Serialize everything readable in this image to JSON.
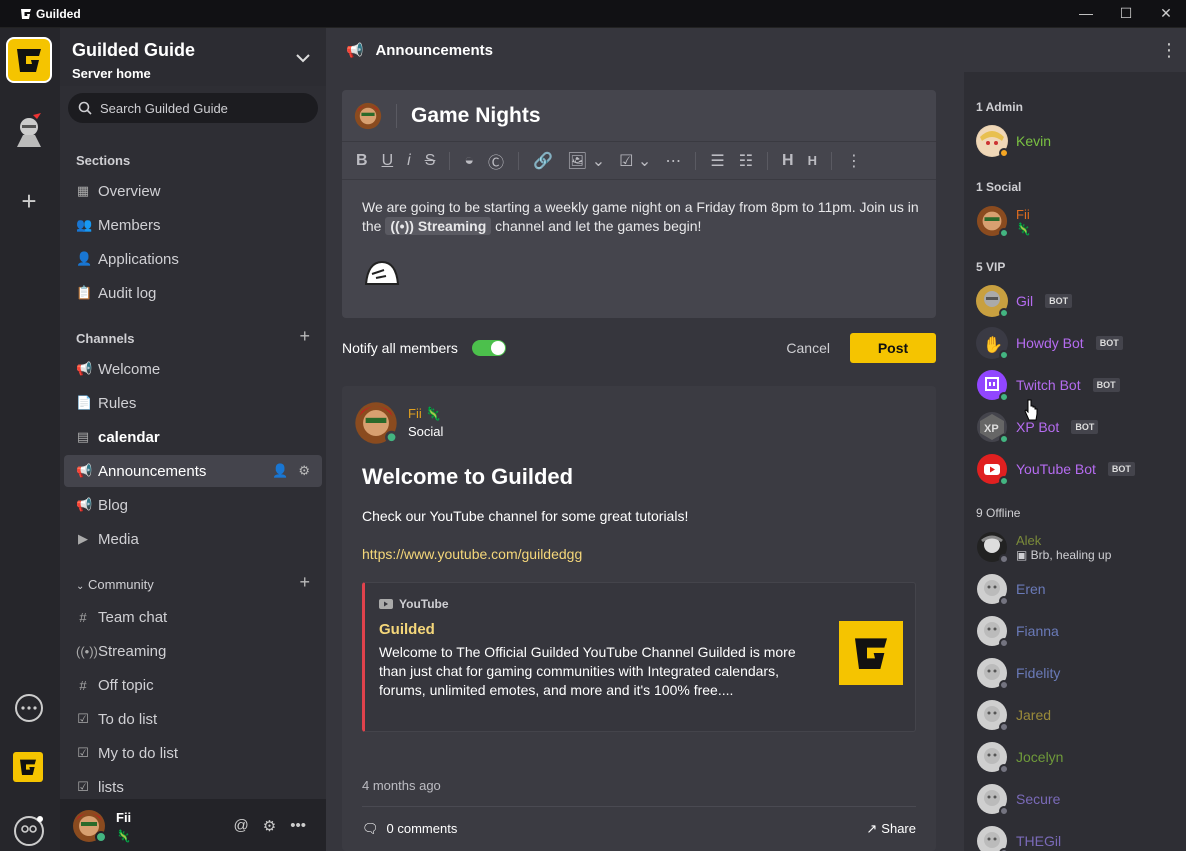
{
  "titlebar": {
    "app_name": "Guilded"
  },
  "server": {
    "name": "Guilded Guide",
    "subtitle": "Server home"
  },
  "search": {
    "placeholder": "Search Guilded Guide"
  },
  "sections": {
    "title": "Sections",
    "items": [
      "Overview",
      "Members",
      "Applications",
      "Audit log"
    ]
  },
  "channels": {
    "title": "Channels",
    "items": [
      "Welcome",
      "Rules",
      "calendar",
      "Announcements",
      "Blog",
      "Media"
    ]
  },
  "community": {
    "title": "Community",
    "items": [
      "Team chat",
      "Streaming",
      "Off topic",
      "To do list",
      "My to do list",
      "lists"
    ]
  },
  "current_user": {
    "name": "Fii",
    "status_emoji": "🦎"
  },
  "header": {
    "channel_title": "Announcements"
  },
  "composer": {
    "title": "Game Nights",
    "body_before": "We are going to be starting a weekly game night on a Friday from 8pm to 11pm.  Join us in the ",
    "chip": "Streaming",
    "body_after": " channel and let the games begin!"
  },
  "notify": {
    "label": "Notify all members",
    "enabled": true
  },
  "actions": {
    "cancel": "Cancel",
    "post": "Post"
  },
  "post": {
    "author": "Fii",
    "author_emoji": "🦎",
    "role": "Social",
    "title": "Welcome to Guilded",
    "text": "Check our YouTube channel for some great tutorials!",
    "link": "https://www.youtube.com/guildedgg",
    "embed": {
      "source": "YouTube",
      "title": "Guilded",
      "description": "Welcome to The Official Guilded YouTube Channel Guilded is more than just chat for gaming communities with Integrated calendars, forums, unlimited emotes, and more and it's 100% free...."
    },
    "time": "4 months ago",
    "comments": "0 comments",
    "share": "Share"
  },
  "members": {
    "admin_title": "1 Admin",
    "social_title": "1 Social",
    "vip_title": "5 VIP",
    "offline_title": "9 Offline",
    "bot_badge": "BOT",
    "admin": [
      {
        "name": "Kevin",
        "color": "#7ac142"
      }
    ],
    "social": [
      {
        "name": "Fii",
        "sub": "🦎",
        "color": "#e06c1f"
      }
    ],
    "vip": [
      {
        "name": "Gil",
        "color": "#b56cf0"
      },
      {
        "name": "Howdy Bot",
        "color": "#b56cf0"
      },
      {
        "name": "Twitch Bot",
        "color": "#b56cf0"
      },
      {
        "name": "XP Bot",
        "color": "#b56cf0"
      },
      {
        "name": "YouTube Bot",
        "color": "#b56cf0"
      }
    ],
    "offline": [
      {
        "name": "Alek",
        "sub": "Brb, healing up",
        "color": "#7a8a3a"
      },
      {
        "name": "Eren",
        "color": "#6a7ab8"
      },
      {
        "name": "Fianna",
        "color": "#6a7ab8"
      },
      {
        "name": "Fidelity",
        "color": "#6a7ab8"
      },
      {
        "name": "Jared",
        "color": "#9a8a3a"
      },
      {
        "name": "Jocelyn",
        "color": "#6f9a3a"
      },
      {
        "name": "Secure",
        "color": "#7a6ab8"
      },
      {
        "name": "THEGil",
        "color": "#7a6ab8"
      }
    ]
  },
  "colors": {
    "accent": "#f5c400",
    "online": "#43b581",
    "offline": "#747480"
  }
}
